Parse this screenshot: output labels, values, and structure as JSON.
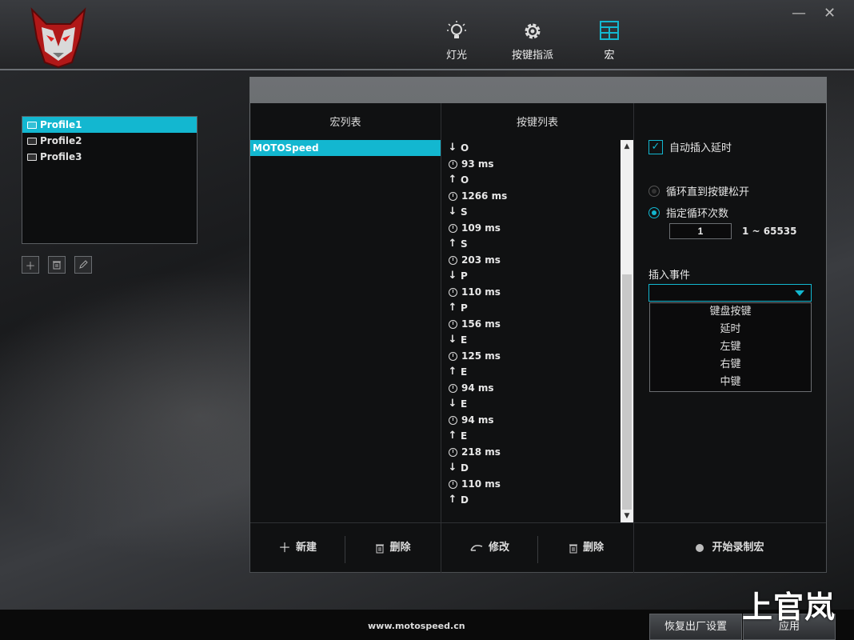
{
  "window": {
    "minimize": "—",
    "close": "✕"
  },
  "nav": [
    {
      "label": "灯光"
    },
    {
      "label": "按键指派"
    },
    {
      "label": "宏"
    }
  ],
  "profiles": [
    "Profile1",
    "Profile2",
    "Profile3"
  ],
  "macro_list": {
    "header": "宏列表",
    "items": [
      "MOTOSpeed"
    ]
  },
  "key_list": {
    "header": "按键列表",
    "rows": [
      {
        "t": "down",
        "v": "O"
      },
      {
        "t": "delay",
        "v": "93 ms"
      },
      {
        "t": "up",
        "v": "O"
      },
      {
        "t": "delay",
        "v": "1266 ms"
      },
      {
        "t": "down",
        "v": "S"
      },
      {
        "t": "delay",
        "v": "109 ms"
      },
      {
        "t": "up",
        "v": "S"
      },
      {
        "t": "delay",
        "v": "203 ms"
      },
      {
        "t": "down",
        "v": "P"
      },
      {
        "t": "delay",
        "v": "110 ms"
      },
      {
        "t": "up",
        "v": "P"
      },
      {
        "t": "delay",
        "v": "156 ms"
      },
      {
        "t": "down",
        "v": "E"
      },
      {
        "t": "delay",
        "v": "125 ms"
      },
      {
        "t": "up",
        "v": "E"
      },
      {
        "t": "delay",
        "v": "94 ms"
      },
      {
        "t": "down",
        "v": "E"
      },
      {
        "t": "delay",
        "v": "94 ms"
      },
      {
        "t": "up",
        "v": "E"
      },
      {
        "t": "delay",
        "v": "218 ms"
      },
      {
        "t": "down",
        "v": "D"
      },
      {
        "t": "delay",
        "v": "110 ms"
      },
      {
        "t": "up",
        "v": "D"
      }
    ]
  },
  "options": {
    "auto_delay": "自动插入延时",
    "loop_until_release": "循环直到按键松开",
    "loop_count": "指定循环次数",
    "count_value": "1",
    "count_range": "1 ~ 65535",
    "insert_event": "插入事件",
    "events": [
      "键盘按键",
      "延时",
      "左键",
      "右键",
      "中键"
    ]
  },
  "bottom": {
    "new": "新建",
    "delete": "删除",
    "modify": "修改",
    "delete2": "删除",
    "record": "开始录制宏"
  },
  "footer": {
    "url": "www.motospeed.cn",
    "reset": "恢复出厂设置",
    "apply": "应用"
  },
  "watermark": "上官岚",
  "colors": {
    "accent": "#13b7d0"
  }
}
